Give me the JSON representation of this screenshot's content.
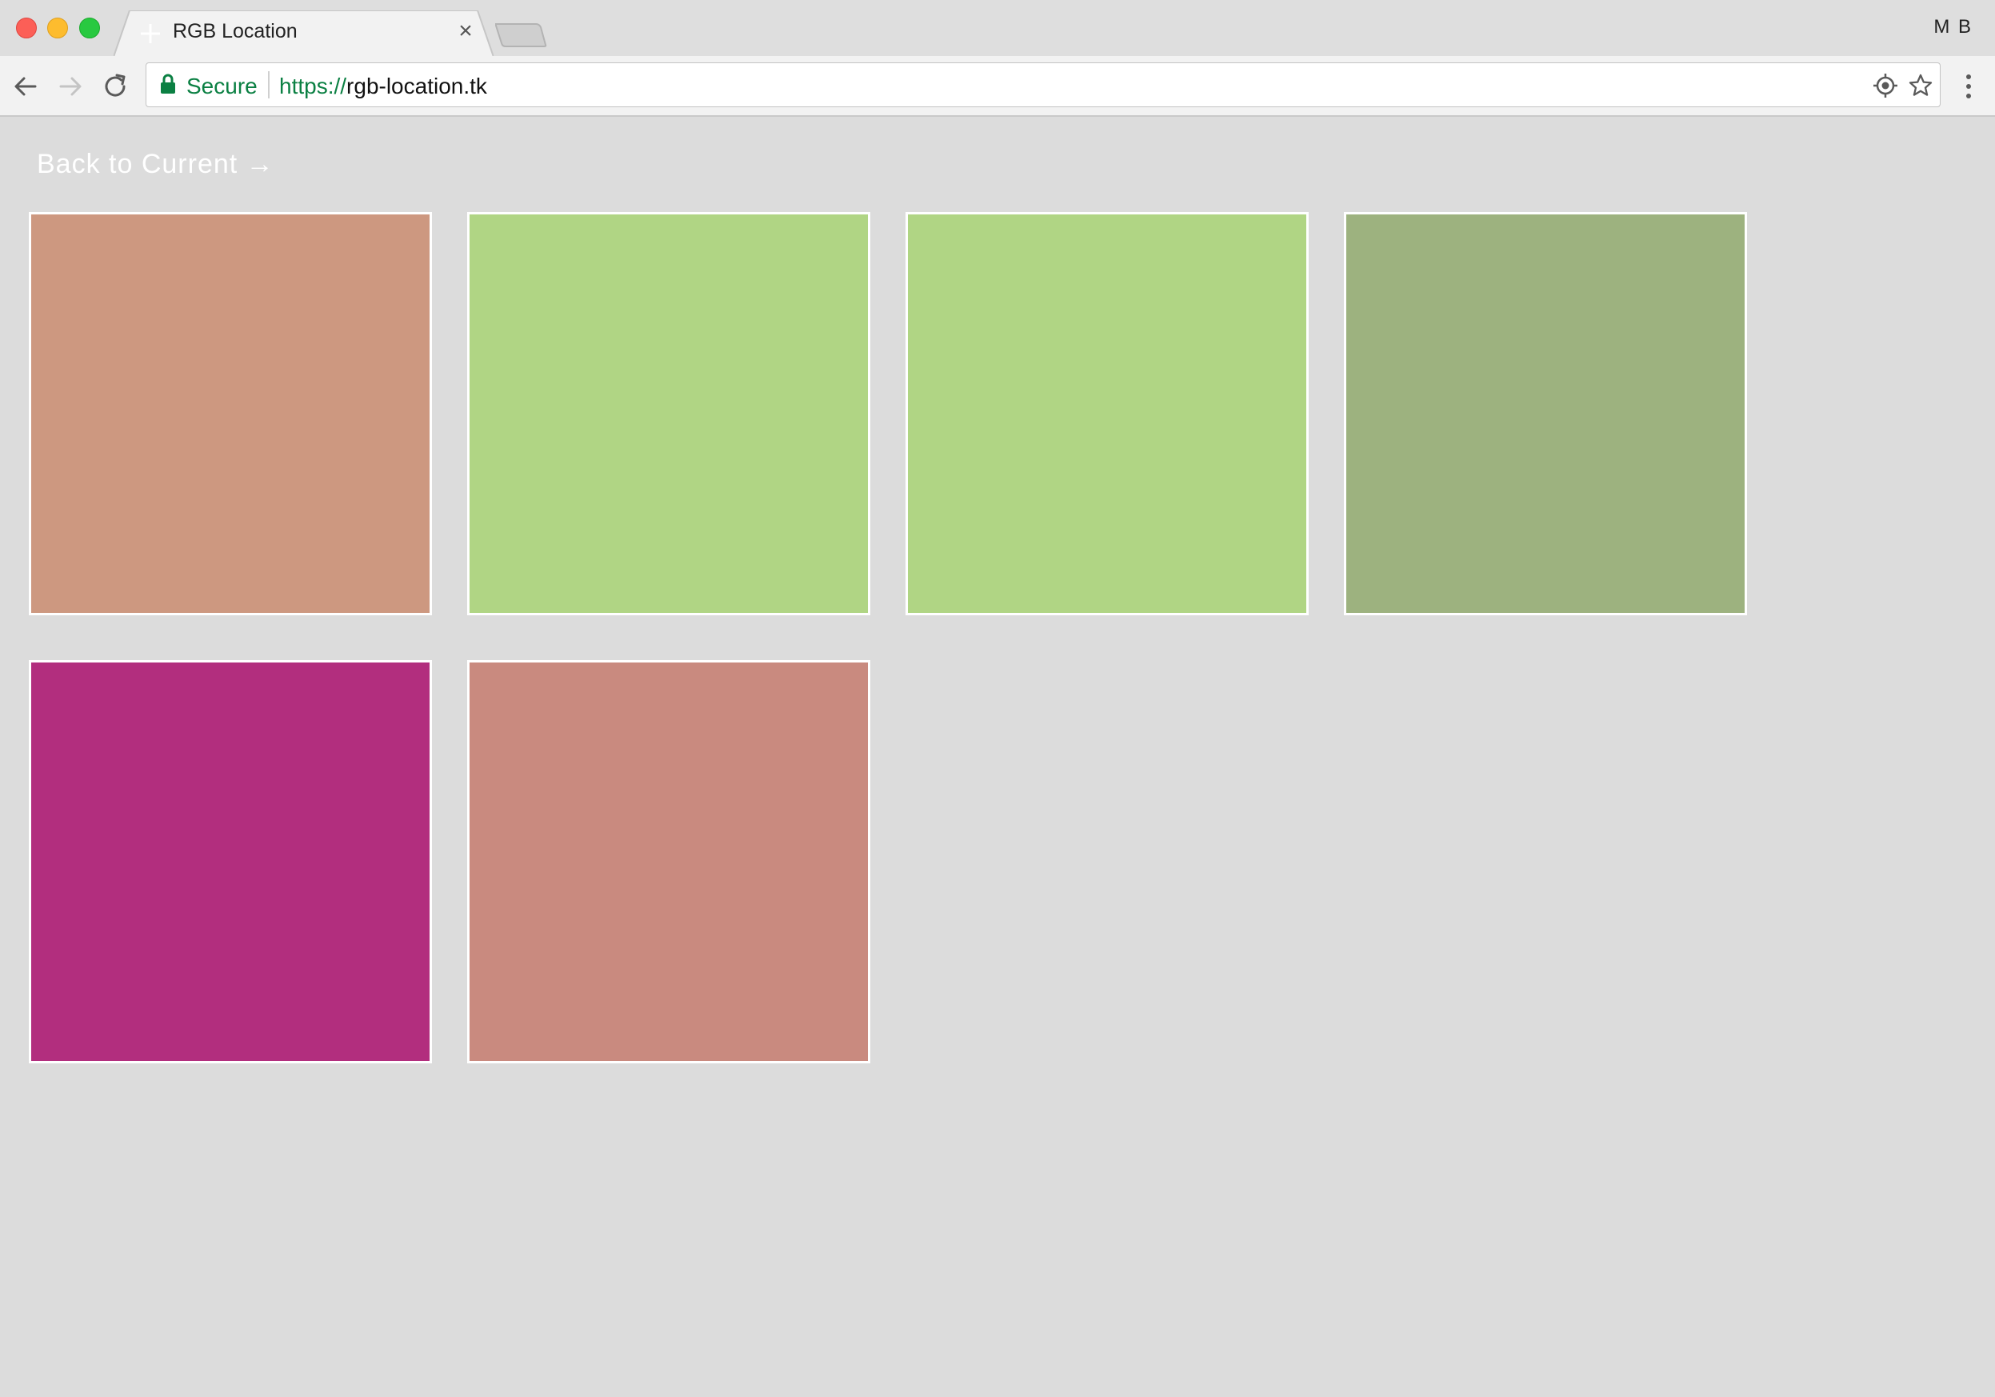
{
  "browser": {
    "tab_title": "RGB Location",
    "tab_close_glyph": "×",
    "profile_initials": "M B",
    "secure_label": "Secure",
    "url_scheme": "https://",
    "url_host": "rgb-location.tk"
  },
  "icons": {
    "back": "arrow-left-icon",
    "forward": "arrow-right-icon",
    "reload": "reload-icon",
    "lock": "lock-icon",
    "location": "location-target-icon",
    "bookmark": "star-icon",
    "menu": "vertical-dots-icon",
    "favicon": "plus-icon"
  },
  "colors": {
    "secure_green": "#0b8043",
    "page_background": "#dcdcdc",
    "swatch_border": "#ffffff"
  },
  "page": {
    "back_link_label": "Back to Current →",
    "swatches": [
      {
        "color": "#cd9880"
      },
      {
        "color": "#b0d584"
      },
      {
        "color": "#b0d584"
      },
      {
        "color": "#9db27f"
      },
      {
        "color": "#b22e7e"
      },
      {
        "color": "#c98a7f"
      }
    ]
  }
}
